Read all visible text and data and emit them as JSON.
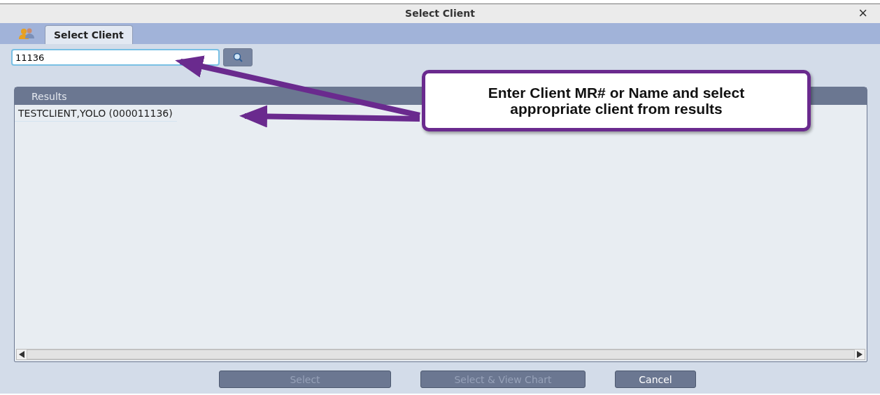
{
  "window": {
    "title": "Select Client",
    "close": "×"
  },
  "tabs": [
    {
      "label": "Select Client",
      "selected": true
    }
  ],
  "search": {
    "value": "11136"
  },
  "results": {
    "header": "Results",
    "rows": [
      {
        "text": "TESTCLIENT,YOLO (000011136)",
        "selected": false
      }
    ]
  },
  "buttons": [
    {
      "label": "Select",
      "disabled": true
    },
    {
      "label": "Select & View Chart",
      "disabled": true
    },
    {
      "label": "Cancel",
      "disabled": false
    }
  ],
  "callout": {
    "text": "Enter Client MR# or Name and select appropriate client from results"
  }
}
